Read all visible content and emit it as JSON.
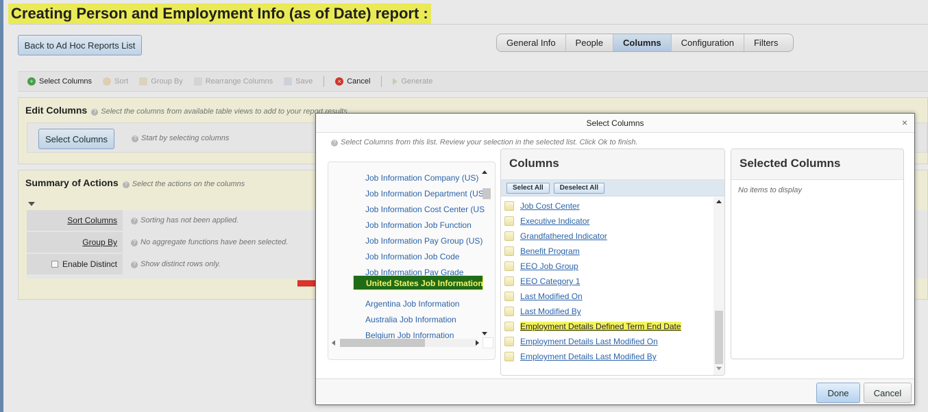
{
  "page": {
    "title": "Creating Person and Employment Info (as of Date) report :",
    "back_button": "Back to Ad Hoc Reports List",
    "tabs": [
      "General Info",
      "People",
      "Columns",
      "Configuration",
      "Filters"
    ],
    "active_tab": "Columns"
  },
  "toolbar": {
    "select_columns": "Select Columns",
    "sort": "Sort",
    "group_by": "Group By",
    "rearrange": "Rearrange Columns",
    "save": "Save",
    "cancel": "Cancel",
    "generate": "Generate"
  },
  "edit_columns": {
    "title": "Edit Columns",
    "hint": "Select the columns from available table views to add to your report results",
    "button": "Select Columns",
    "button_hint": "Start by selecting columns"
  },
  "summary": {
    "title": "Summary of Actions",
    "hint": "Select the actions on the columns",
    "rows": [
      {
        "label": "Sort Columns",
        "hint": "Sorting has not been applied."
      },
      {
        "label": "Group By",
        "hint": "No aggregate functions have been selected."
      },
      {
        "label": "Enable Distinct",
        "hint": "Show distinct rows only."
      }
    ]
  },
  "modal": {
    "title": "Select Columns",
    "hint": "Select Columns from this list. Review your selection in the selected list. Click Ok to finish.",
    "views": [
      "Job Information Company (US)",
      "Job Information Department (US",
      "Job Information Cost Center (US",
      "Job Information Job Function",
      "Job Information Pay Group (US)",
      "Job Information Job Code",
      "Job Information Pay Grade",
      "United States Job Information",
      "Argentina Job Information",
      "Australia Job Information",
      "Belgium Job Information"
    ],
    "selected_view": "United States Job Information",
    "columns_title": "Columns",
    "select_all": "Select All",
    "deselect_all": "Deselect All",
    "columns": [
      "Job Cost Center",
      "Executive Indicator",
      "Grandfathered Indicator",
      "Benefit Program",
      "EEO Job Group",
      "EEO Category 1",
      "Last Modified On",
      "Last Modified By",
      "Employment Details Defined Term End Date",
      "Employment Details Last Modified On",
      "Employment Details Last Modified By"
    ],
    "highlighted_column": "Employment Details Defined Term End Date",
    "selected_title": "Selected Columns",
    "selected_empty": "No items to display",
    "done": "Done",
    "cancel": "Cancel",
    "close_symbol": "×"
  },
  "colors": {
    "highlight": "#f4f45a",
    "selected_view_bg": "#1f6b16",
    "link": "#2b63a8",
    "arrow": "#e0322b"
  }
}
